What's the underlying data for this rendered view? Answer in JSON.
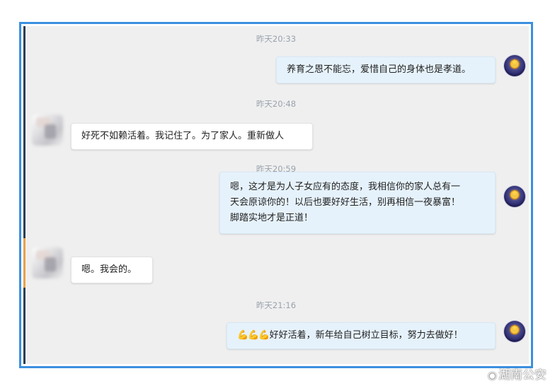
{
  "messages": [
    {
      "type": "timestamp",
      "text": "昨天20:33"
    },
    {
      "type": "message",
      "side": "right",
      "text": "养育之恩不能忘，爱惜自己的身体也是孝道。"
    },
    {
      "type": "timestamp",
      "text": "昨天20:48"
    },
    {
      "type": "message",
      "side": "left",
      "text": "好死不如赖活着。我记住了。为了家人。重新做人"
    },
    {
      "type": "timestamp",
      "text": "昨天20:59"
    },
    {
      "type": "message",
      "side": "right",
      "lines": [
        "嗯，这才是为人子女应有的态度，我相信你的家人总有一",
        "天会原谅你的！以后也要好好生活，别再相信一夜暴富！",
        "脚踏实地才是正道！"
      ]
    },
    {
      "type": "message",
      "side": "left",
      "text": "嗯。我会的。"
    },
    {
      "type": "timestamp",
      "text": "昨天21:16"
    },
    {
      "type": "message",
      "side": "right",
      "emoji": "💪💪💪",
      "text": "好好活着，新年给自己树立目标，努力去做好！"
    }
  ],
  "watermark": {
    "icon": "weibo-icon",
    "text": "湖南公安"
  },
  "colors": {
    "frame": "#3b8fe0",
    "bubble_right": "#e6f2fb",
    "background": "#efefef"
  }
}
